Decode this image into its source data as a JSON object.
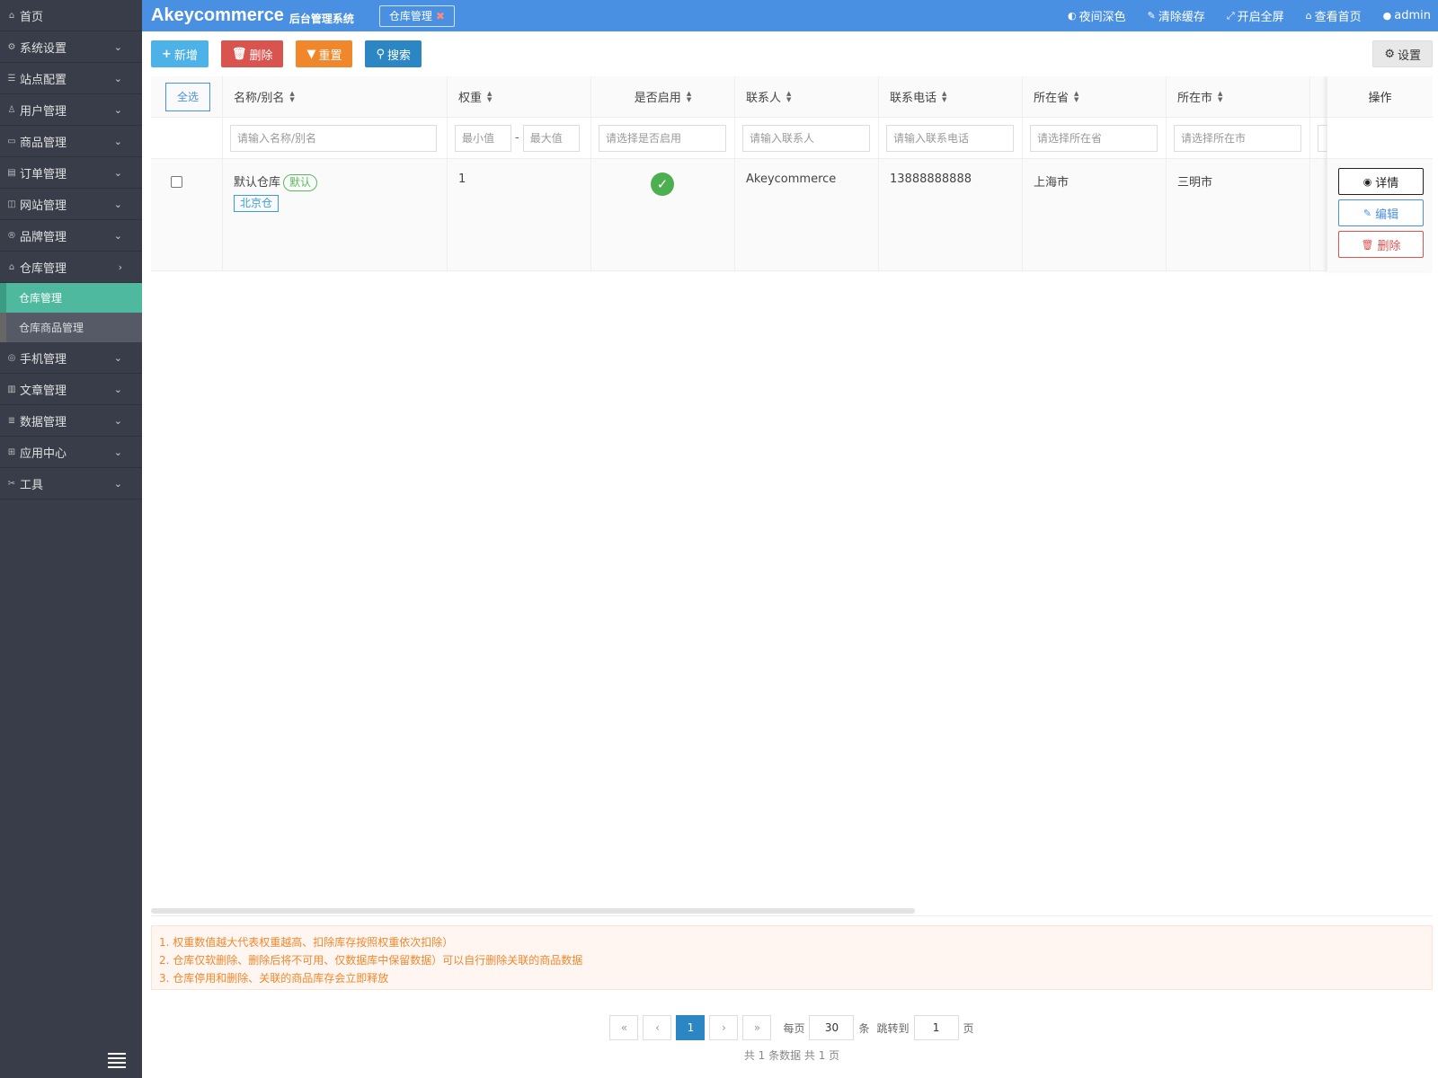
{
  "sidebar": {
    "items": [
      {
        "label": "首页",
        "icon": "home-icon",
        "chevron": ""
      },
      {
        "label": "系统设置",
        "icon": "gear-icon",
        "chevron": "⌄"
      },
      {
        "label": "站点配置",
        "icon": "sliders-icon",
        "chevron": "⌄"
      },
      {
        "label": "用户管理",
        "icon": "user-icon",
        "chevron": "⌄"
      },
      {
        "label": "商品管理",
        "icon": "box-icon",
        "chevron": "⌄"
      },
      {
        "label": "订单管理",
        "icon": "order-icon",
        "chevron": "⌄"
      },
      {
        "label": "网站管理",
        "icon": "site-icon",
        "chevron": "⌄"
      },
      {
        "label": "品牌管理",
        "icon": "brand-icon",
        "chevron": "⌄"
      },
      {
        "label": "仓库管理",
        "icon": "warehouse-icon",
        "chevron": "›"
      }
    ],
    "sub_items": [
      {
        "label": "仓库管理",
        "active": true
      },
      {
        "label": "仓库商品管理",
        "active": false
      }
    ],
    "items_after": [
      {
        "label": "手机管理",
        "icon": "phone-icon",
        "chevron": "⌄"
      },
      {
        "label": "文章管理",
        "icon": "article-icon",
        "chevron": "⌄"
      },
      {
        "label": "数据管理",
        "icon": "database-icon",
        "chevron": "⌄"
      },
      {
        "label": "应用中心",
        "icon": "apps-icon",
        "chevron": "⌄"
      },
      {
        "label": "工具",
        "icon": "tools-icon",
        "chevron": "⌄"
      }
    ]
  },
  "header": {
    "brand": "Akeycommerce",
    "brand_sub": "后台管理系统",
    "tab_label": "仓库管理",
    "tab_close": "✖",
    "links": {
      "night_mode": "夜间深色",
      "clear_cache": "清除缓存",
      "fullscreen": "开启全屏",
      "view_home": "查看首页",
      "user": "admin"
    }
  },
  "toolbar": {
    "add": "新增",
    "delete": "删除",
    "reset": "重置",
    "search": "搜索",
    "settings": "设置"
  },
  "table": {
    "select_all": "全选",
    "columns": {
      "name": "名称/别名",
      "weight": "权重",
      "enabled": "是否启用",
      "contact": "联系人",
      "phone": "联系电话",
      "province": "所在省",
      "city": "所在市",
      "operations": "操作"
    },
    "filters": {
      "name": "请输入名称/别名",
      "weight_min": "最小值",
      "weight_sep": "-",
      "weight_max": "最大值",
      "enabled": "请选择是否启用",
      "contact": "请输入联系人",
      "phone": "请输入联系电话",
      "province": "请选择所在省",
      "city": "请选择所在市"
    },
    "rows": [
      {
        "name": "默认仓库",
        "default_tag": "默认",
        "alias_tag": "北京仓",
        "weight": "1",
        "enabled": true,
        "contact": "Akeycommerce",
        "phone": "13888888888",
        "province": "上海市",
        "city": "三明市"
      }
    ],
    "row_actions": {
      "detail": "详情",
      "edit": "编辑",
      "delete": "删除"
    }
  },
  "notice": {
    "lines": [
      "1. 权重数值越大代表权重越高、扣除库存按照权重依次扣除）",
      "2. 仓库仅软删除、删除后将不可用、仅数据库中保留数据）可以自行删除关联的商品数据",
      "3. 仓库停用和删除、关联的商品库存会立即释放"
    ]
  },
  "pagination": {
    "first": "«",
    "prev": "‹",
    "current": "1",
    "next": "›",
    "last": "»",
    "per_page_label": "每页",
    "per_page": "30",
    "per_page_unit": "条",
    "jump_label": "跳转到",
    "jump_page": "1",
    "page_unit": "页",
    "summary": "共 1 条数据   共 1 页"
  },
  "colors": {
    "header": "#4a90e2",
    "sidebar": "#393d49",
    "active_menu": "#4fb99f",
    "notice_text": "#f0882e"
  }
}
